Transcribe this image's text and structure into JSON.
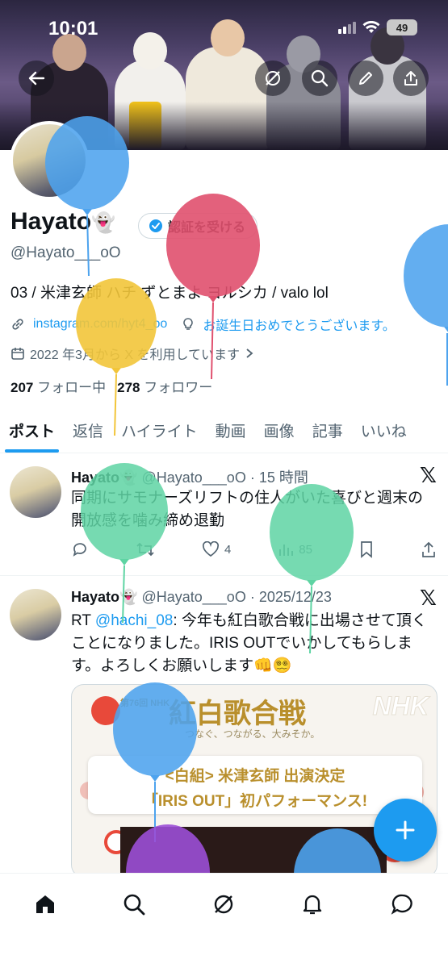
{
  "status_bar": {
    "time": "10:01",
    "battery": "49"
  },
  "profile": {
    "display_name": "Hayato",
    "name_emoji": "👻",
    "verify_label": "認証を受ける",
    "handle": "@Hayato___oO",
    "bio": "03 / 米津玄師 ハチ ずとまよ ヨルシカ / valo lol",
    "link_text": "instagram.com/hyt4_oo",
    "birthday_text": "お誕生日おめでとうございます。",
    "joined_text": "2022 年3月から X を利用しています",
    "following_count": "207",
    "following_label": "フォロー中",
    "followers_count": "278",
    "followers_label": "フォロワー"
  },
  "tabs": [
    "ポスト",
    "返信",
    "ハイライト",
    "動画",
    "画像",
    "記事",
    "いいね"
  ],
  "posts": [
    {
      "author": "Hayato",
      "emoji": "👻",
      "meta": "@Hayato___oO · 15 時間",
      "text": "同期にサモナーズリフトの住人がいた喜びと週末の開放感を噛み締め退勤",
      "likes": "4",
      "views": "85"
    },
    {
      "author": "Hayato",
      "emoji": "👻",
      "meta": "@Hayato___oO · 2025/12/23",
      "text_prefix": "RT ",
      "mention": "@hachi_08",
      "text": ": 今年も紅白歌合戦に出場させて頂くことになりました。IRIS OUTでいかしてもらします。よろしくお願いします👊😵‍💫",
      "media": {
        "title": "紅白歌合戦",
        "edition": "第76回 NHK",
        "subtitle": "つなぐ、つながる、大みそか。",
        "brand": "NHK",
        "line1": "<白組> 米津玄師 出演決定",
        "line2": "「IRIS OUT」初パフォーマンス!"
      }
    }
  ],
  "colors": {
    "accent": "#1d9bf0",
    "text": "#0f1419",
    "muted": "#536471"
  },
  "icons": [
    "back-arrow-icon",
    "slashed-circle-icon",
    "search-icon",
    "edit-icon",
    "share-icon",
    "verified-badge-icon",
    "link-icon",
    "bulb-icon",
    "calendar-icon",
    "chevron-right-icon",
    "x-logo-icon",
    "reply-icon",
    "repost-icon",
    "like-icon",
    "views-icon",
    "bookmark-icon",
    "plus-icon",
    "home-icon",
    "grok-icon",
    "bell-icon",
    "messages-icon"
  ]
}
